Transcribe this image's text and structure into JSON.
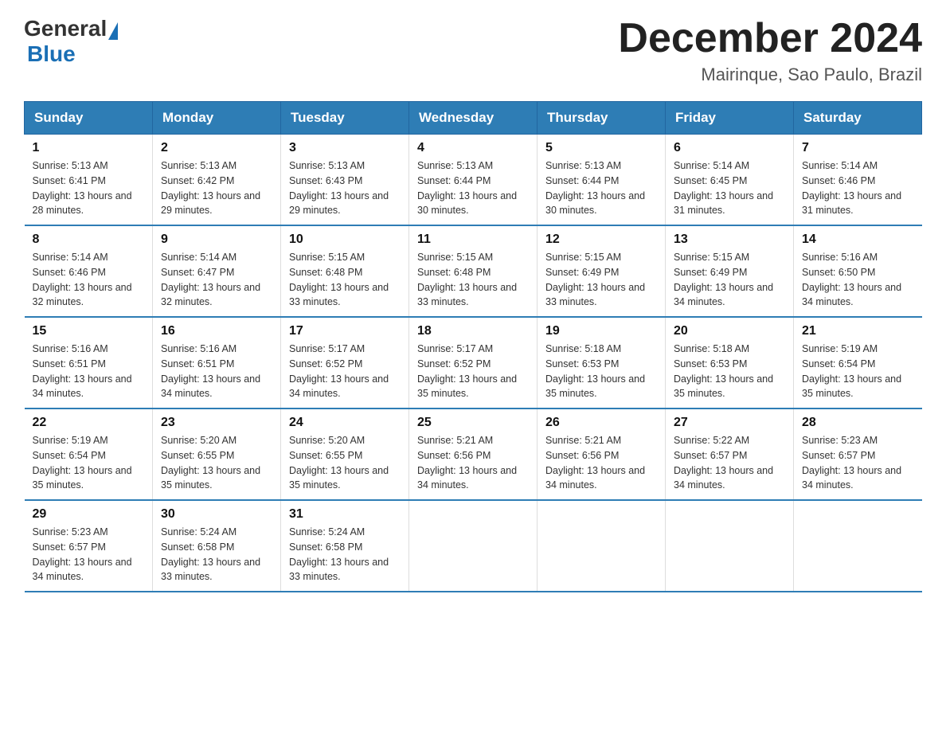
{
  "header": {
    "logo_general": "General",
    "logo_blue": "Blue",
    "month_title": "December 2024",
    "location": "Mairinque, Sao Paulo, Brazil"
  },
  "weekdays": [
    "Sunday",
    "Monday",
    "Tuesday",
    "Wednesday",
    "Thursday",
    "Friday",
    "Saturday"
  ],
  "weeks": [
    [
      {
        "day": "1",
        "sunrise": "5:13 AM",
        "sunset": "6:41 PM",
        "daylight": "13 hours and 28 minutes."
      },
      {
        "day": "2",
        "sunrise": "5:13 AM",
        "sunset": "6:42 PM",
        "daylight": "13 hours and 29 minutes."
      },
      {
        "day": "3",
        "sunrise": "5:13 AM",
        "sunset": "6:43 PM",
        "daylight": "13 hours and 29 minutes."
      },
      {
        "day": "4",
        "sunrise": "5:13 AM",
        "sunset": "6:44 PM",
        "daylight": "13 hours and 30 minutes."
      },
      {
        "day": "5",
        "sunrise": "5:13 AM",
        "sunset": "6:44 PM",
        "daylight": "13 hours and 30 minutes."
      },
      {
        "day": "6",
        "sunrise": "5:14 AM",
        "sunset": "6:45 PM",
        "daylight": "13 hours and 31 minutes."
      },
      {
        "day": "7",
        "sunrise": "5:14 AM",
        "sunset": "6:46 PM",
        "daylight": "13 hours and 31 minutes."
      }
    ],
    [
      {
        "day": "8",
        "sunrise": "5:14 AM",
        "sunset": "6:46 PM",
        "daylight": "13 hours and 32 minutes."
      },
      {
        "day": "9",
        "sunrise": "5:14 AM",
        "sunset": "6:47 PM",
        "daylight": "13 hours and 32 minutes."
      },
      {
        "day": "10",
        "sunrise": "5:15 AM",
        "sunset": "6:48 PM",
        "daylight": "13 hours and 33 minutes."
      },
      {
        "day": "11",
        "sunrise": "5:15 AM",
        "sunset": "6:48 PM",
        "daylight": "13 hours and 33 minutes."
      },
      {
        "day": "12",
        "sunrise": "5:15 AM",
        "sunset": "6:49 PM",
        "daylight": "13 hours and 33 minutes."
      },
      {
        "day": "13",
        "sunrise": "5:15 AM",
        "sunset": "6:49 PM",
        "daylight": "13 hours and 34 minutes."
      },
      {
        "day": "14",
        "sunrise": "5:16 AM",
        "sunset": "6:50 PM",
        "daylight": "13 hours and 34 minutes."
      }
    ],
    [
      {
        "day": "15",
        "sunrise": "5:16 AM",
        "sunset": "6:51 PM",
        "daylight": "13 hours and 34 minutes."
      },
      {
        "day": "16",
        "sunrise": "5:16 AM",
        "sunset": "6:51 PM",
        "daylight": "13 hours and 34 minutes."
      },
      {
        "day": "17",
        "sunrise": "5:17 AM",
        "sunset": "6:52 PM",
        "daylight": "13 hours and 34 minutes."
      },
      {
        "day": "18",
        "sunrise": "5:17 AM",
        "sunset": "6:52 PM",
        "daylight": "13 hours and 35 minutes."
      },
      {
        "day": "19",
        "sunrise": "5:18 AM",
        "sunset": "6:53 PM",
        "daylight": "13 hours and 35 minutes."
      },
      {
        "day": "20",
        "sunrise": "5:18 AM",
        "sunset": "6:53 PM",
        "daylight": "13 hours and 35 minutes."
      },
      {
        "day": "21",
        "sunrise": "5:19 AM",
        "sunset": "6:54 PM",
        "daylight": "13 hours and 35 minutes."
      }
    ],
    [
      {
        "day": "22",
        "sunrise": "5:19 AM",
        "sunset": "6:54 PM",
        "daylight": "13 hours and 35 minutes."
      },
      {
        "day": "23",
        "sunrise": "5:20 AM",
        "sunset": "6:55 PM",
        "daylight": "13 hours and 35 minutes."
      },
      {
        "day": "24",
        "sunrise": "5:20 AM",
        "sunset": "6:55 PM",
        "daylight": "13 hours and 35 minutes."
      },
      {
        "day": "25",
        "sunrise": "5:21 AM",
        "sunset": "6:56 PM",
        "daylight": "13 hours and 34 minutes."
      },
      {
        "day": "26",
        "sunrise": "5:21 AM",
        "sunset": "6:56 PM",
        "daylight": "13 hours and 34 minutes."
      },
      {
        "day": "27",
        "sunrise": "5:22 AM",
        "sunset": "6:57 PM",
        "daylight": "13 hours and 34 minutes."
      },
      {
        "day": "28",
        "sunrise": "5:23 AM",
        "sunset": "6:57 PM",
        "daylight": "13 hours and 34 minutes."
      }
    ],
    [
      {
        "day": "29",
        "sunrise": "5:23 AM",
        "sunset": "6:57 PM",
        "daylight": "13 hours and 34 minutes."
      },
      {
        "day": "30",
        "sunrise": "5:24 AM",
        "sunset": "6:58 PM",
        "daylight": "13 hours and 33 minutes."
      },
      {
        "day": "31",
        "sunrise": "5:24 AM",
        "sunset": "6:58 PM",
        "daylight": "13 hours and 33 minutes."
      },
      null,
      null,
      null,
      null
    ]
  ]
}
